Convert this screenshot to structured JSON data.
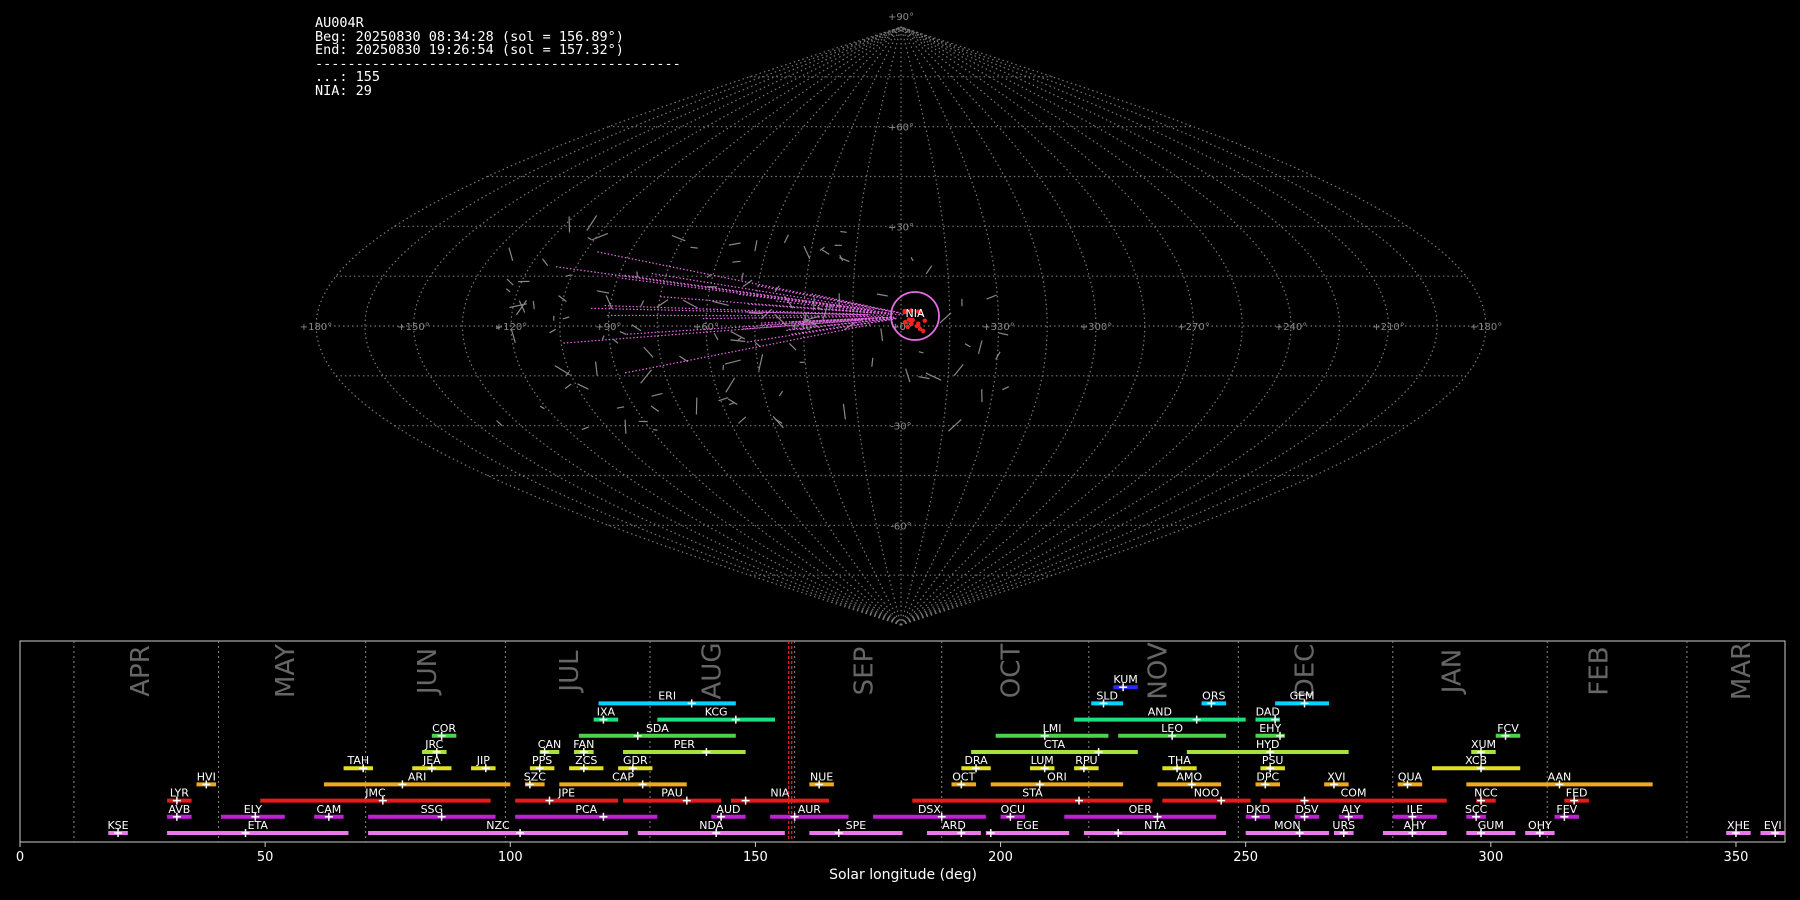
{
  "header": {
    "station": "AU004R",
    "begin": "Beg: 20250830 08:34:28 (sol = 156.89°)",
    "end": "End: 20250830 19:26:54 (sol = 157.32°)",
    "separator": "---------------------------------------------",
    "count_sporadic": "...: 155",
    "count_nia": "NIA: 29"
  },
  "colors": {
    "background": "#000000",
    "grid": "#777777",
    "nia_trail": "#e76ce7",
    "radiant": "#ff2020",
    "marker_line": "#ff2020"
  },
  "chart_data": [
    {
      "type": "scatter",
      "projection": "sinusoidal",
      "grid": true,
      "lon_ticks": [
        "+180°",
        "+150°",
        "+120°",
        "+90°",
        "+60°",
        "+30°",
        "+0°",
        "+330°",
        "+300°",
        "+270°",
        "+240°",
        "+210°",
        "+180°"
      ],
      "lat_ticks": [
        "+90°",
        "+60°",
        "+30°",
        "+0°",
        "-30°",
        "-60°",
        "-90°"
      ],
      "radiant_label": "NIA",
      "radiant_center": [
        355,
        -2
      ],
      "radiant_radius_deg": 7
    },
    {
      "type": "bar",
      "orientation": "timeline",
      "xlabel": "Solar longitude (deg)",
      "xlim": [
        0,
        360
      ],
      "xticks": [
        0,
        50,
        100,
        150,
        200,
        250,
        300,
        350
      ],
      "current_sol": 157.1,
      "months": [
        {
          "name": "APR",
          "boundary": 11,
          "center": 24.5
        },
        {
          "name": "MAY",
          "boundary": 40.5,
          "center": 54
        },
        {
          "name": "JUN",
          "boundary": 70.5,
          "center": 83
        },
        {
          "name": "JUL",
          "boundary": 99,
          "center": 112
        },
        {
          "name": "AUG",
          "boundary": 128.5,
          "center": 141
        },
        {
          "name": "SEP",
          "boundary": 158,
          "center": 172
        },
        {
          "name": "OCT",
          "boundary": 188,
          "center": 202
        },
        {
          "name": "NOV",
          "boundary": 218,
          "center": 232
        },
        {
          "name": "DEC",
          "boundary": 248.5,
          "center": 262
        },
        {
          "name": "JAN",
          "boundary": 280,
          "center": 292
        },
        {
          "name": "FEB",
          "boundary": 311.5,
          "center": 322
        },
        {
          "name": "MAR",
          "boundary": 340,
          "center": 351
        }
      ],
      "showers": [
        {
          "name": "KUM",
          "start": 223,
          "end": 228,
          "peak": 225,
          "row": 10,
          "color": "#2a2aff"
        },
        {
          "name": "ERI",
          "start": 118,
          "end": 146,
          "peak": 137,
          "row": 9,
          "color": "#00d4ff"
        },
        {
          "name": "SLD",
          "start": 218.5,
          "end": 225,
          "peak": 221,
          "row": 9,
          "color": "#00d4ff"
        },
        {
          "name": "ORS",
          "start": 241,
          "end": 246,
          "peak": 243,
          "row": 9,
          "color": "#00d4ff"
        },
        {
          "name": "GEM",
          "start": 256,
          "end": 267,
          "peak": 262,
          "row": 9,
          "color": "#00d4ff"
        },
        {
          "name": "IXA",
          "start": 117,
          "end": 122,
          "peak": 119,
          "row": 8,
          "color": "#18e07a"
        },
        {
          "name": "KCG",
          "start": 130,
          "end": 154,
          "peak": 146,
          "row": 8,
          "color": "#18e07a"
        },
        {
          "name": "AND",
          "start": 215,
          "end": 250,
          "peak": 240,
          "row": 8,
          "color": "#18e07a"
        },
        {
          "name": "DAD",
          "start": 252,
          "end": 257,
          "peak": 256,
          "row": 8,
          "color": "#18e07a"
        },
        {
          "name": "COR",
          "start": 84,
          "end": 89,
          "peak": 86,
          "row": 7,
          "color": "#4dd24d"
        },
        {
          "name": "SDA",
          "start": 114,
          "end": 146,
          "peak": 126,
          "row": 7,
          "color": "#4dd24d"
        },
        {
          "name": "LMI",
          "start": 199,
          "end": 222,
          "peak": 209,
          "row": 7,
          "color": "#4dd24d"
        },
        {
          "name": "LEO",
          "start": 224,
          "end": 246,
          "peak": 235,
          "row": 7,
          "color": "#4dd24d"
        },
        {
          "name": "EHY",
          "start": 252,
          "end": 258,
          "peak": 257,
          "row": 7,
          "color": "#4dd24d"
        },
        {
          "name": "FCV",
          "start": 301,
          "end": 306,
          "peak": 303,
          "row": 7,
          "color": "#4dd24d"
        },
        {
          "name": "JRC",
          "start": 82,
          "end": 87,
          "peak": 85,
          "row": 6,
          "color": "#a6e33a"
        },
        {
          "name": "CAN",
          "start": 106,
          "end": 110,
          "peak": 107,
          "row": 6,
          "color": "#a6e33a"
        },
        {
          "name": "FAN",
          "start": 113,
          "end": 117,
          "peak": 115,
          "row": 6,
          "color": "#a6e33a"
        },
        {
          "name": "PER",
          "start": 123,
          "end": 148,
          "peak": 140,
          "row": 6,
          "color": "#a6e33a"
        },
        {
          "name": "CTA",
          "start": 194,
          "end": 228,
          "peak": 220,
          "row": 6,
          "color": "#a6e33a"
        },
        {
          "name": "HYD",
          "start": 238,
          "end": 271,
          "peak": 255,
          "row": 6,
          "color": "#a6e33a"
        },
        {
          "name": "XUM",
          "start": 296,
          "end": 301,
          "peak": 298,
          "row": 6,
          "color": "#a6e33a"
        },
        {
          "name": "TAH",
          "start": 66,
          "end": 72,
          "peak": 70,
          "row": 5,
          "color": "#dfe020"
        },
        {
          "name": "JEA",
          "start": 80,
          "end": 88,
          "peak": 84,
          "row": 5,
          "color": "#dfe020"
        },
        {
          "name": "JIP",
          "start": 92,
          "end": 97,
          "peak": 95,
          "row": 5,
          "color": "#dfe020"
        },
        {
          "name": "PPS",
          "start": 104,
          "end": 109,
          "peak": 106,
          "row": 5,
          "color": "#dfe020"
        },
        {
          "name": "ZCS",
          "start": 112,
          "end": 119,
          "peak": 115,
          "row": 5,
          "color": "#dfe020"
        },
        {
          "name": "GDR",
          "start": 122,
          "end": 129,
          "peak": 125,
          "row": 5,
          "color": "#dfe020"
        },
        {
          "name": "DRA",
          "start": 192,
          "end": 198,
          "peak": 195,
          "row": 5,
          "color": "#dfe020"
        },
        {
          "name": "LUM",
          "start": 206,
          "end": 211,
          "peak": 209,
          "row": 5,
          "color": "#dfe020"
        },
        {
          "name": "RPU",
          "start": 215,
          "end": 220,
          "peak": 217,
          "row": 5,
          "color": "#dfe020"
        },
        {
          "name": "THA",
          "start": 233,
          "end": 240,
          "peak": 236,
          "row": 5,
          "color": "#dfe020"
        },
        {
          "name": "PSU",
          "start": 253,
          "end": 258,
          "peak": 255,
          "row": 5,
          "color": "#dfe020"
        },
        {
          "name": "XCB",
          "start": 288,
          "end": 306,
          "peak": 298,
          "row": 5,
          "color": "#dfe020"
        },
        {
          "name": "HVI",
          "start": 36,
          "end": 40,
          "peak": 38,
          "row": 4,
          "color": "#f2a91d"
        },
        {
          "name": "ARI",
          "start": 62,
          "end": 100,
          "peak": 78,
          "row": 4,
          "color": "#f2a91d"
        },
        {
          "name": "SZC",
          "start": 103,
          "end": 107,
          "peak": 104,
          "row": 4,
          "color": "#f2a91d"
        },
        {
          "name": "CAP",
          "start": 110,
          "end": 136,
          "peak": 127,
          "row": 4,
          "color": "#f2a91d"
        },
        {
          "name": "NUE",
          "start": 161,
          "end": 166,
          "peak": 163,
          "row": 4,
          "color": "#f2a91d"
        },
        {
          "name": "OCT",
          "start": 190,
          "end": 195,
          "peak": 192,
          "row": 4,
          "color": "#f2a91d"
        },
        {
          "name": "ORI",
          "start": 198,
          "end": 225,
          "peak": 208,
          "row": 4,
          "color": "#f2a91d"
        },
        {
          "name": "AMO",
          "start": 232,
          "end": 245,
          "peak": 239,
          "row": 4,
          "color": "#f2a91d"
        },
        {
          "name": "DPC",
          "start": 252,
          "end": 257,
          "peak": 254,
          "row": 4,
          "color": "#f2a91d"
        },
        {
          "name": "XVI",
          "start": 266,
          "end": 271,
          "peak": 268,
          "row": 4,
          "color": "#f2a91d"
        },
        {
          "name": "QUA",
          "start": 281,
          "end": 286,
          "peak": 283,
          "row": 4,
          "color": "#f2a91d"
        },
        {
          "name": "AAN",
          "start": 295,
          "end": 333,
          "peak": 314,
          "row": 4,
          "color": "#f2a91d"
        },
        {
          "name": "LYR",
          "start": 30,
          "end": 35,
          "peak": 32,
          "row": 3,
          "color": "#e81a1a"
        },
        {
          "name": "JMC",
          "start": 49,
          "end": 96,
          "peak": 74,
          "row": 3,
          "color": "#e81a1a"
        },
        {
          "name": "JPE",
          "start": 101,
          "end": 122,
          "peak": 108,
          "row": 3,
          "color": "#e81a1a"
        },
        {
          "name": "PAU",
          "start": 123,
          "end": 143,
          "peak": 136,
          "row": 3,
          "color": "#e81a1a"
        },
        {
          "name": "NIA",
          "start": 145,
          "end": 165,
          "peak": 148,
          "row": 3,
          "color": "#e81a1a"
        },
        {
          "name": "STA",
          "start": 182,
          "end": 231,
          "peak": 216,
          "row": 3,
          "color": "#e81a1a"
        },
        {
          "name": "NOO",
          "start": 233,
          "end": 251,
          "peak": 245,
          "row": 3,
          "color": "#e81a1a"
        },
        {
          "name": "COM",
          "start": 253,
          "end": 291,
          "peak": 262,
          "row": 3,
          "color": "#e81a1a"
        },
        {
          "name": "NCC",
          "start": 297,
          "end": 301,
          "peak": 298,
          "row": 3,
          "color": "#e81a1a"
        },
        {
          "name": "FED",
          "start": 315,
          "end": 320,
          "peak": 317,
          "row": 3,
          "color": "#e81a1a"
        },
        {
          "name": "AVB",
          "start": 30,
          "end": 35,
          "peak": 32,
          "row": 2,
          "color": "#c21fd6"
        },
        {
          "name": "ELY",
          "start": 41,
          "end": 54,
          "peak": 48,
          "row": 2,
          "color": "#c21fd6"
        },
        {
          "name": "CAM",
          "start": 60,
          "end": 66,
          "peak": 63,
          "row": 2,
          "color": "#c21fd6"
        },
        {
          "name": "SSG",
          "start": 71,
          "end": 97,
          "peak": 86,
          "row": 2,
          "color": "#c21fd6"
        },
        {
          "name": "PCA",
          "start": 101,
          "end": 130,
          "peak": 119,
          "row": 2,
          "color": "#c21fd6"
        },
        {
          "name": "AUD",
          "start": 141,
          "end": 148,
          "peak": 143,
          "row": 2,
          "color": "#c21fd6"
        },
        {
          "name": "AUR",
          "start": 153,
          "end": 169,
          "peak": 158,
          "row": 2,
          "color": "#c21fd6"
        },
        {
          "name": "DSX",
          "start": 174,
          "end": 197,
          "peak": 188,
          "row": 2,
          "color": "#c21fd6"
        },
        {
          "name": "OCU",
          "start": 200,
          "end": 205,
          "peak": 202,
          "row": 2,
          "color": "#c21fd6"
        },
        {
          "name": "OER",
          "start": 213,
          "end": 244,
          "peak": 232,
          "row": 2,
          "color": "#c21fd6"
        },
        {
          "name": "DKD",
          "start": 250,
          "end": 255,
          "peak": 252,
          "row": 2,
          "color": "#c21fd6"
        },
        {
          "name": "DSV",
          "start": 260,
          "end": 265,
          "peak": 262,
          "row": 2,
          "color": "#c21fd6"
        },
        {
          "name": "ALY",
          "start": 269,
          "end": 274,
          "peak": 271,
          "row": 2,
          "color": "#c21fd6"
        },
        {
          "name": "ILE",
          "start": 280,
          "end": 289,
          "peak": 284,
          "row": 2,
          "color": "#c21fd6"
        },
        {
          "name": "SCC",
          "start": 295,
          "end": 299,
          "peak": 297,
          "row": 2,
          "color": "#c21fd6"
        },
        {
          "name": "FEV",
          "start": 313,
          "end": 318,
          "peak": 315,
          "row": 2,
          "color": "#c21fd6"
        },
        {
          "name": "KSE",
          "start": 18,
          "end": 22,
          "peak": 20,
          "row": 1,
          "color": "#e87ae8"
        },
        {
          "name": "ETA",
          "start": 30,
          "end": 67,
          "peak": 46,
          "row": 1,
          "color": "#e87ae8"
        },
        {
          "name": "NZC",
          "start": 71,
          "end": 124,
          "peak": 102,
          "row": 1,
          "color": "#e87ae8"
        },
        {
          "name": "NDA",
          "start": 126,
          "end": 156,
          "peak": 142,
          "row": 1,
          "color": "#e87ae8"
        },
        {
          "name": "SPE",
          "start": 161,
          "end": 180,
          "peak": 167,
          "row": 1,
          "color": "#e87ae8"
        },
        {
          "name": "ARD",
          "start": 185,
          "end": 196,
          "peak": 192,
          "row": 1,
          "color": "#e87ae8"
        },
        {
          "name": "EGE",
          "start": 197,
          "end": 214,
          "peak": 198,
          "row": 1,
          "color": "#e87ae8"
        },
        {
          "name": "NTA",
          "start": 217,
          "end": 246,
          "peak": 224,
          "row": 1,
          "color": "#e87ae8"
        },
        {
          "name": "MON",
          "start": 250,
          "end": 267,
          "peak": 261,
          "row": 1,
          "color": "#e87ae8"
        },
        {
          "name": "URS",
          "start": 268,
          "end": 272,
          "peak": 270,
          "row": 1,
          "color": "#e87ae8"
        },
        {
          "name": "AHY",
          "start": 278,
          "end": 291,
          "peak": 284,
          "row": 1,
          "color": "#e87ae8"
        },
        {
          "name": "GUM",
          "start": 295,
          "end": 305,
          "peak": 298,
          "row": 1,
          "color": "#e87ae8"
        },
        {
          "name": "OHY",
          "start": 307,
          "end": 313,
          "peak": 310,
          "row": 1,
          "color": "#e87ae8"
        },
        {
          "name": "XHE",
          "start": 348,
          "end": 353,
          "peak": 350,
          "row": 1,
          "color": "#e87ae8"
        },
        {
          "name": "EVI",
          "start": 355,
          "end": 360,
          "peak": 358,
          "row": 1,
          "color": "#e87ae8"
        }
      ]
    }
  ]
}
